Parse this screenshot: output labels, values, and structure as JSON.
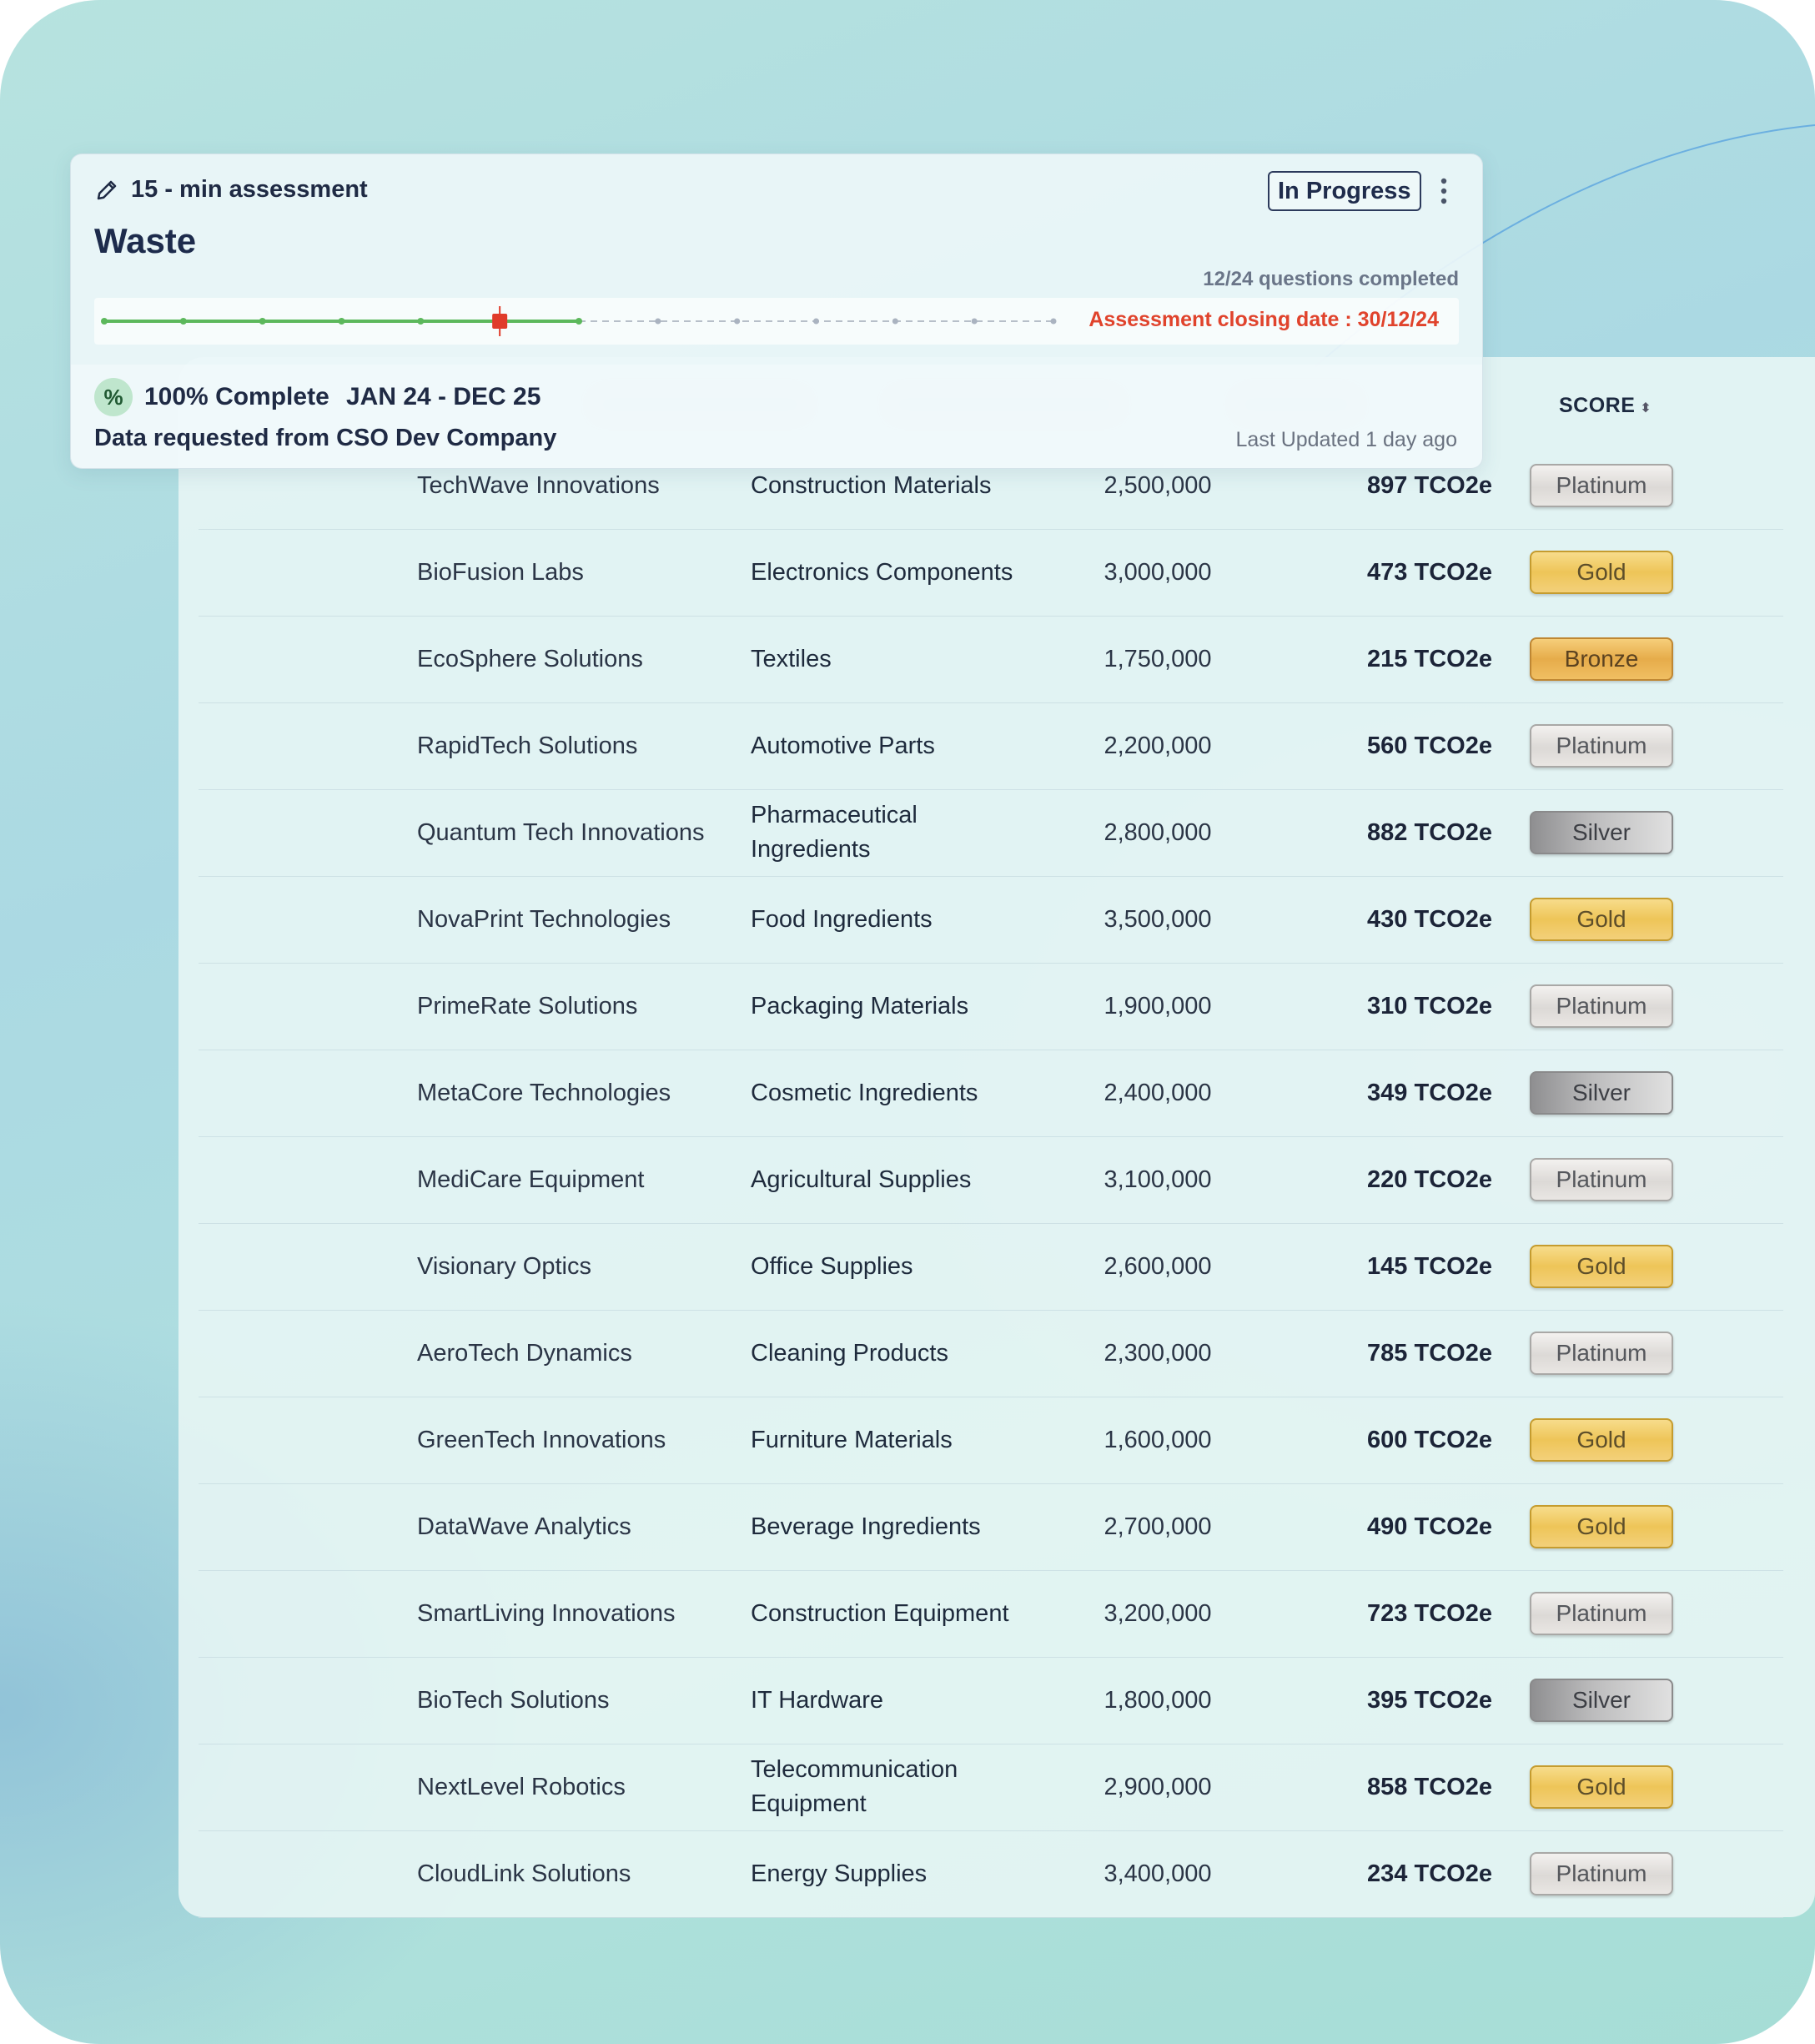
{
  "assessment": {
    "type_label": "15 - min assessment",
    "title": "Waste",
    "status": "In Progress",
    "questions_completed": "12/24 questions completed",
    "closing_date": "Assessment closing date : 30/12/24",
    "progress_fraction": 0.5,
    "completion": "100% Complete",
    "completion_icon": "%",
    "period": "JAN 24 - DEC 25",
    "requested_from": "Data requested from CSO Dev Company",
    "last_updated": "Last Updated 1 day ago"
  },
  "table": {
    "score_header": "SCORE",
    "sort_icon": "sort-icon",
    "rows": [
      {
        "company": "TechWave Innovations",
        "category": "Construction Materials",
        "quantity": "2,500,000",
        "emissions": "897 TCO2e",
        "score": "Platinum"
      },
      {
        "company": "BioFusion Labs",
        "category": "Electronics Components",
        "quantity": "3,000,000",
        "emissions": "473 TCO2e",
        "score": "Gold"
      },
      {
        "company": "EcoSphere Solutions",
        "category": "Textiles",
        "quantity": "1,750,000",
        "emissions": "215 TCO2e",
        "score": "Bronze"
      },
      {
        "company": "RapidTech Solutions",
        "category": "Automotive Parts",
        "quantity": "2,200,000",
        "emissions": "560 TCO2e",
        "score": "Platinum"
      },
      {
        "company": "Quantum Tech Innovations",
        "category": "Pharmaceutical Ingredients",
        "quantity": "2,800,000",
        "emissions": "882 TCO2e",
        "score": "Silver"
      },
      {
        "company": "NovaPrint Technologies",
        "category": "Food Ingredients",
        "quantity": "3,500,000",
        "emissions": "430 TCO2e",
        "score": "Gold"
      },
      {
        "company": "PrimeRate Solutions",
        "category": "Packaging Materials",
        "quantity": "1,900,000",
        "emissions": "310 TCO2e",
        "score": "Platinum"
      },
      {
        "company": "MetaCore Technologies",
        "category": "Cosmetic Ingredients",
        "quantity": "2,400,000",
        "emissions": "349 TCO2e",
        "score": "Silver"
      },
      {
        "company": "MediCare Equipment",
        "category": "Agricultural Supplies",
        "quantity": "3,100,000",
        "emissions": "220 TCO2e",
        "score": "Platinum"
      },
      {
        "company": "Visionary Optics",
        "category": "Office Supplies",
        "quantity": "2,600,000",
        "emissions": "145 TCO2e",
        "score": "Gold"
      },
      {
        "company": "AeroTech Dynamics",
        "category": "Cleaning Products",
        "quantity": "2,300,000",
        "emissions": "785 TCO2e",
        "score": "Platinum"
      },
      {
        "company": "GreenTech Innovations",
        "category": "Furniture Materials",
        "quantity": "1,600,000",
        "emissions": "600 TCO2e",
        "score": "Gold"
      },
      {
        "company": "DataWave Analytics",
        "category": "Beverage Ingredients",
        "quantity": "2,700,000",
        "emissions": "490 TCO2e",
        "score": "Gold"
      },
      {
        "company": "SmartLiving Innovations",
        "category": "Construction Equipment",
        "quantity": "3,200,000",
        "emissions": "723 TCO2e",
        "score": "Platinum"
      },
      {
        "company": "BioTech Solutions",
        "category": "IT Hardware",
        "quantity": "1,800,000",
        "emissions": "395 TCO2e",
        "score": "Silver"
      },
      {
        "company": "NextLevel Robotics",
        "category": "Telecommunication Equipment",
        "quantity": "2,900,000",
        "emissions": "858 TCO2e",
        "score": "Gold"
      },
      {
        "company": "CloudLink Solutions",
        "category": "Energy Supplies",
        "quantity": "3,400,000",
        "emissions": "234 TCO2e",
        "score": "Platinum"
      }
    ]
  },
  "colors": {
    "progress_done": "#5cb85c",
    "progress_marker": "#e03b2a",
    "closing_text": "#e0432c"
  }
}
